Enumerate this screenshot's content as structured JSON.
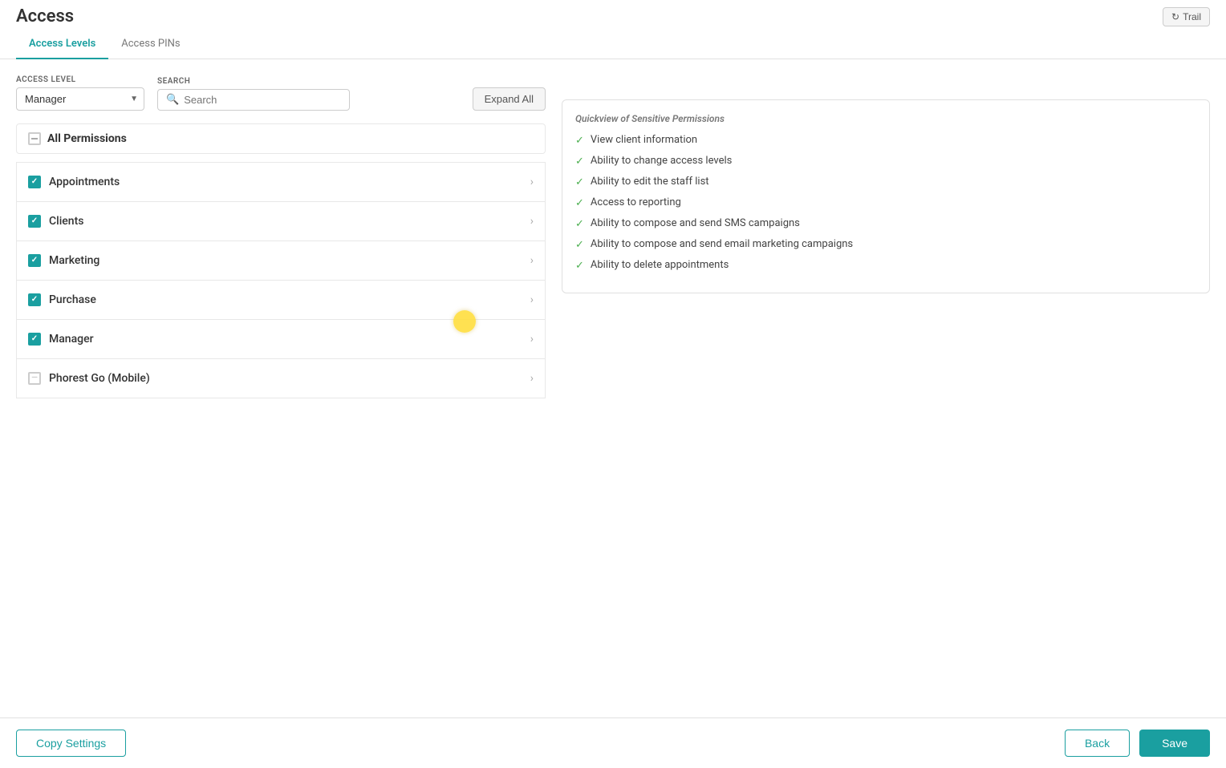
{
  "page": {
    "title": "Access",
    "trail_button": "Trail"
  },
  "tabs": [
    {
      "id": "access-levels",
      "label": "Access Levels",
      "active": true
    },
    {
      "id": "access-pins",
      "label": "Access PINs",
      "active": false
    }
  ],
  "controls": {
    "access_level_label": "ACCESS LEVEL",
    "access_level_value": "Manager",
    "search_label": "SEARCH",
    "search_placeholder": "Search",
    "expand_all_label": "Expand All"
  },
  "all_permissions": {
    "label": "All Permissions"
  },
  "permissions": [
    {
      "id": "appointments",
      "name": "Appointments",
      "checked": true
    },
    {
      "id": "clients",
      "name": "Clients",
      "checked": true
    },
    {
      "id": "marketing",
      "name": "Marketing",
      "checked": true
    },
    {
      "id": "purchase",
      "name": "Purchase",
      "checked": true
    },
    {
      "id": "manager",
      "name": "Manager",
      "checked": true
    },
    {
      "id": "phorest-go",
      "name": "Phorest Go (Mobile)",
      "checked": false,
      "partial": true
    }
  ],
  "quickview": {
    "title": "Quickview of Sensitive Permissions",
    "items": [
      "View client information",
      "Ability to change access levels",
      "Ability to edit the staff list",
      "Access to reporting",
      "Ability to compose and send SMS campaigns",
      "Ability to compose and send email marketing campaigns",
      "Ability to delete appointments"
    ]
  },
  "footer": {
    "copy_settings_label": "Copy Settings",
    "back_label": "Back",
    "save_label": "Save"
  }
}
